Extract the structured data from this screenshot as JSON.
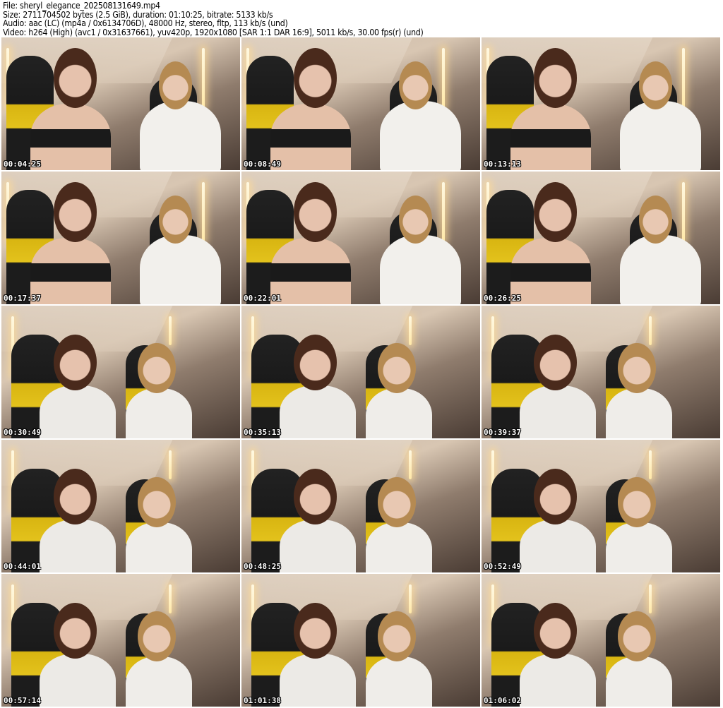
{
  "header": {
    "file": "File: sheryl_elegance_202508131649.mp4",
    "size": "Size: 2711704502 bytes (2.5 GiB), duration: 01:10:25, bitrate: 5133 kb/s",
    "audio": "Audio: aac (LC) (mp4a / 0x6134706D), 48000 Hz, stereo, fltp, 113 kb/s (und)",
    "video": "Video: h264 (High) (avc1 / 0x31637661), yuv420p, 1920x1080 [SAR 1:1 DAR 16:9], 5011 kb/s, 30.00 fps(r) (und)"
  },
  "thumbnails": [
    {
      "timestamp": "00:04:25",
      "scene": "wide"
    },
    {
      "timestamp": "00:08:49",
      "scene": "wide"
    },
    {
      "timestamp": "00:13:13",
      "scene": "wide"
    },
    {
      "timestamp": "00:17:37",
      "scene": "wide"
    },
    {
      "timestamp": "00:22:01",
      "scene": "wide"
    },
    {
      "timestamp": "00:26:25",
      "scene": "wide"
    },
    {
      "timestamp": "00:30:49",
      "scene": "close"
    },
    {
      "timestamp": "00:35:13",
      "scene": "close"
    },
    {
      "timestamp": "00:39:37",
      "scene": "close"
    },
    {
      "timestamp": "00:44:01",
      "scene": "close"
    },
    {
      "timestamp": "00:48:25",
      "scene": "close"
    },
    {
      "timestamp": "00:52:49",
      "scene": "close"
    },
    {
      "timestamp": "00:57:14",
      "scene": "close"
    },
    {
      "timestamp": "01:01:38",
      "scene": "close"
    },
    {
      "timestamp": "01:06:02",
      "scene": "close"
    }
  ]
}
